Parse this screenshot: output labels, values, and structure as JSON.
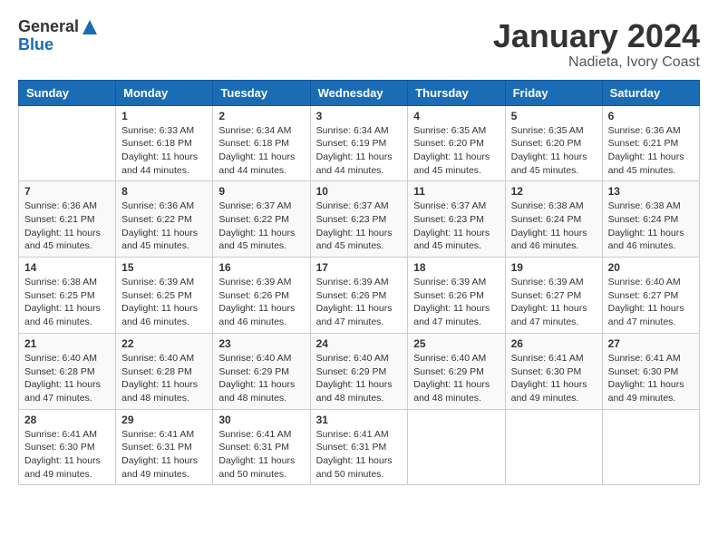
{
  "logo": {
    "general": "General",
    "blue": "Blue"
  },
  "title": "January 2024",
  "location": "Nadieta, Ivory Coast",
  "weekdays": [
    "Sunday",
    "Monday",
    "Tuesday",
    "Wednesday",
    "Thursday",
    "Friday",
    "Saturday"
  ],
  "weeks": [
    [
      {
        "day": "",
        "info": ""
      },
      {
        "day": "1",
        "info": "Sunrise: 6:33 AM\nSunset: 6:18 PM\nDaylight: 11 hours and 44 minutes."
      },
      {
        "day": "2",
        "info": "Sunrise: 6:34 AM\nSunset: 6:18 PM\nDaylight: 11 hours and 44 minutes."
      },
      {
        "day": "3",
        "info": "Sunrise: 6:34 AM\nSunset: 6:19 PM\nDaylight: 11 hours and 44 minutes."
      },
      {
        "day": "4",
        "info": "Sunrise: 6:35 AM\nSunset: 6:20 PM\nDaylight: 11 hours and 45 minutes."
      },
      {
        "day": "5",
        "info": "Sunrise: 6:35 AM\nSunset: 6:20 PM\nDaylight: 11 hours and 45 minutes."
      },
      {
        "day": "6",
        "info": "Sunrise: 6:36 AM\nSunset: 6:21 PM\nDaylight: 11 hours and 45 minutes."
      }
    ],
    [
      {
        "day": "7",
        "info": "Sunrise: 6:36 AM\nSunset: 6:21 PM\nDaylight: 11 hours and 45 minutes."
      },
      {
        "day": "8",
        "info": "Sunrise: 6:36 AM\nSunset: 6:22 PM\nDaylight: 11 hours and 45 minutes."
      },
      {
        "day": "9",
        "info": "Sunrise: 6:37 AM\nSunset: 6:22 PM\nDaylight: 11 hours and 45 minutes."
      },
      {
        "day": "10",
        "info": "Sunrise: 6:37 AM\nSunset: 6:23 PM\nDaylight: 11 hours and 45 minutes."
      },
      {
        "day": "11",
        "info": "Sunrise: 6:37 AM\nSunset: 6:23 PM\nDaylight: 11 hours and 45 minutes."
      },
      {
        "day": "12",
        "info": "Sunrise: 6:38 AM\nSunset: 6:24 PM\nDaylight: 11 hours and 46 minutes."
      },
      {
        "day": "13",
        "info": "Sunrise: 6:38 AM\nSunset: 6:24 PM\nDaylight: 11 hours and 46 minutes."
      }
    ],
    [
      {
        "day": "14",
        "info": "Sunrise: 6:38 AM\nSunset: 6:25 PM\nDaylight: 11 hours and 46 minutes."
      },
      {
        "day": "15",
        "info": "Sunrise: 6:39 AM\nSunset: 6:25 PM\nDaylight: 11 hours and 46 minutes."
      },
      {
        "day": "16",
        "info": "Sunrise: 6:39 AM\nSunset: 6:26 PM\nDaylight: 11 hours and 46 minutes."
      },
      {
        "day": "17",
        "info": "Sunrise: 6:39 AM\nSunset: 6:26 PM\nDaylight: 11 hours and 47 minutes."
      },
      {
        "day": "18",
        "info": "Sunrise: 6:39 AM\nSunset: 6:26 PM\nDaylight: 11 hours and 47 minutes."
      },
      {
        "day": "19",
        "info": "Sunrise: 6:39 AM\nSunset: 6:27 PM\nDaylight: 11 hours and 47 minutes."
      },
      {
        "day": "20",
        "info": "Sunrise: 6:40 AM\nSunset: 6:27 PM\nDaylight: 11 hours and 47 minutes."
      }
    ],
    [
      {
        "day": "21",
        "info": "Sunrise: 6:40 AM\nSunset: 6:28 PM\nDaylight: 11 hours and 47 minutes."
      },
      {
        "day": "22",
        "info": "Sunrise: 6:40 AM\nSunset: 6:28 PM\nDaylight: 11 hours and 48 minutes."
      },
      {
        "day": "23",
        "info": "Sunrise: 6:40 AM\nSunset: 6:29 PM\nDaylight: 11 hours and 48 minutes."
      },
      {
        "day": "24",
        "info": "Sunrise: 6:40 AM\nSunset: 6:29 PM\nDaylight: 11 hours and 48 minutes."
      },
      {
        "day": "25",
        "info": "Sunrise: 6:40 AM\nSunset: 6:29 PM\nDaylight: 11 hours and 48 minutes."
      },
      {
        "day": "26",
        "info": "Sunrise: 6:41 AM\nSunset: 6:30 PM\nDaylight: 11 hours and 49 minutes."
      },
      {
        "day": "27",
        "info": "Sunrise: 6:41 AM\nSunset: 6:30 PM\nDaylight: 11 hours and 49 minutes."
      }
    ],
    [
      {
        "day": "28",
        "info": "Sunrise: 6:41 AM\nSunset: 6:30 PM\nDaylight: 11 hours and 49 minutes."
      },
      {
        "day": "29",
        "info": "Sunrise: 6:41 AM\nSunset: 6:31 PM\nDaylight: 11 hours and 49 minutes."
      },
      {
        "day": "30",
        "info": "Sunrise: 6:41 AM\nSunset: 6:31 PM\nDaylight: 11 hours and 50 minutes."
      },
      {
        "day": "31",
        "info": "Sunrise: 6:41 AM\nSunset: 6:31 PM\nDaylight: 11 hours and 50 minutes."
      },
      {
        "day": "",
        "info": ""
      },
      {
        "day": "",
        "info": ""
      },
      {
        "day": "",
        "info": ""
      }
    ]
  ]
}
